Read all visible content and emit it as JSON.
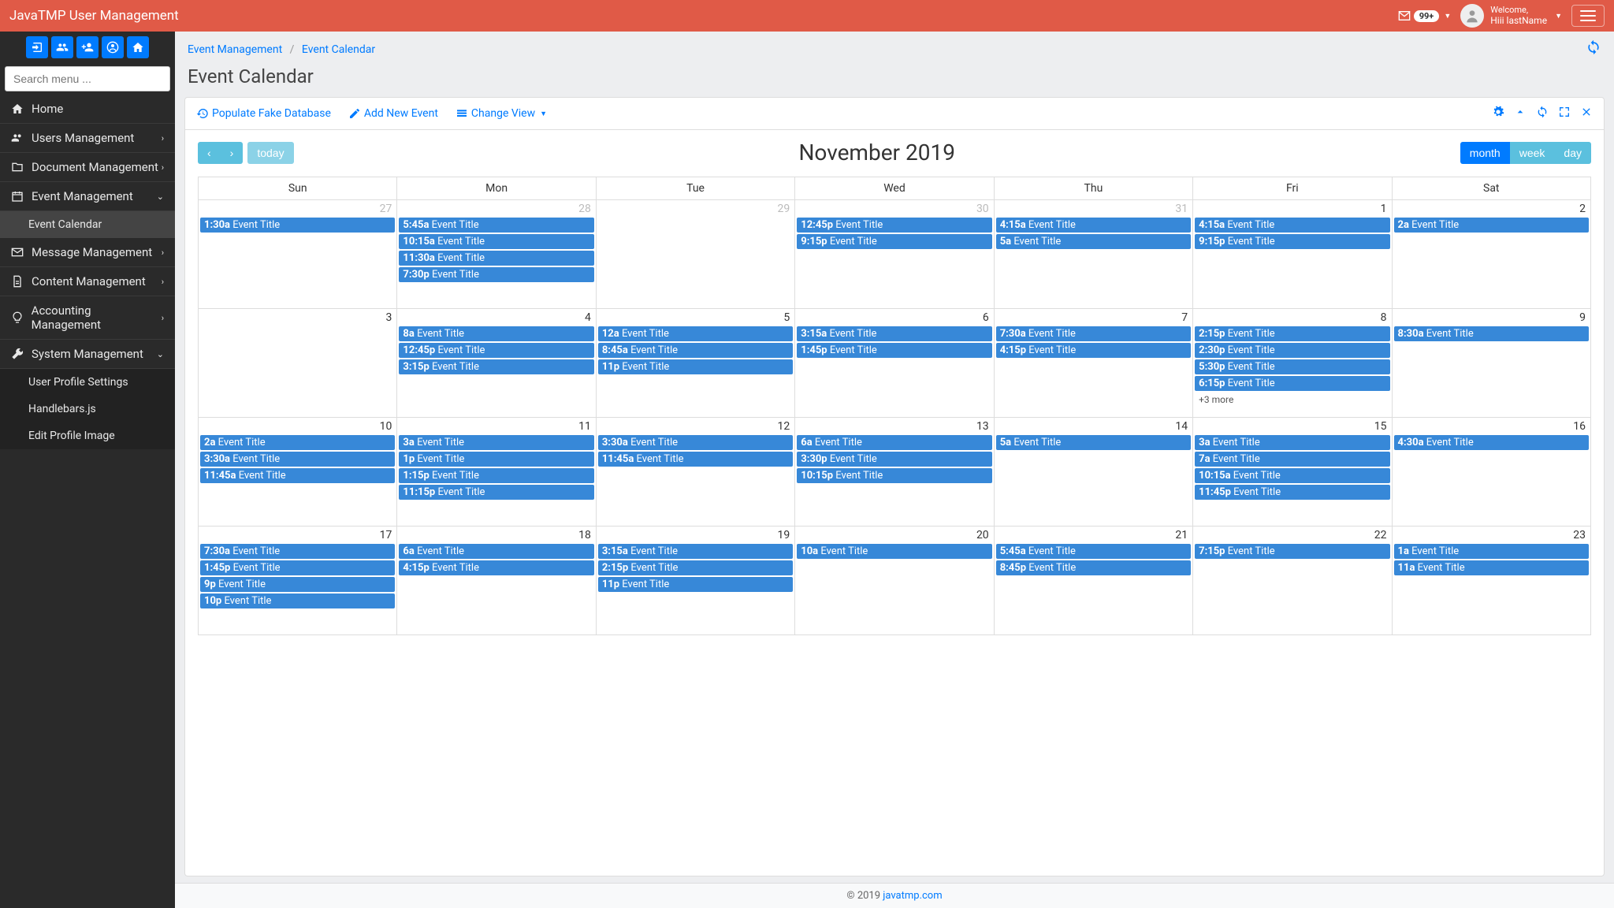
{
  "app": {
    "title": "JavaTMP User Management"
  },
  "header": {
    "notification_count": "99+",
    "welcome": "Welcome,",
    "username": "Hiii lastName"
  },
  "sidebar": {
    "search_placeholder": "Search menu ...",
    "items": [
      {
        "label": "Home",
        "icon": "home"
      },
      {
        "label": "Users Management",
        "icon": "users",
        "expandable": true
      },
      {
        "label": "Document Management",
        "icon": "folder",
        "expandable": true
      },
      {
        "label": "Event Management",
        "icon": "calendar",
        "expandable": true,
        "open": true,
        "children": [
          {
            "label": "Event Calendar",
            "active": true
          }
        ]
      },
      {
        "label": "Message Management",
        "icon": "mail",
        "expandable": true
      },
      {
        "label": "Content Management",
        "icon": "doc",
        "expandable": true
      },
      {
        "label": "Accounting Management",
        "icon": "bulb",
        "expandable": true
      },
      {
        "label": "System Management",
        "icon": "wrench",
        "expandable": true,
        "open": true,
        "children": [
          {
            "label": "User Profile Settings"
          },
          {
            "label": "Handlebars.js"
          },
          {
            "label": "Edit Profile Image"
          }
        ]
      }
    ]
  },
  "breadcrumb": {
    "parent": "Event Management",
    "current": "Event Calendar"
  },
  "page": {
    "title": "Event Calendar"
  },
  "panel_actions": {
    "populate": "Populate Fake Database",
    "add": "Add New Event",
    "view": "Change View"
  },
  "calendar": {
    "title": "November 2019",
    "today_label": "today",
    "views": {
      "month": "month",
      "week": "week",
      "day": "day"
    },
    "day_headers": [
      "Sun",
      "Mon",
      "Tue",
      "Wed",
      "Thu",
      "Fri",
      "Sat"
    ],
    "weeks": [
      [
        {
          "num": "27",
          "other": true,
          "events": [
            {
              "t": "1:30a",
              "title": "Event Title"
            }
          ]
        },
        {
          "num": "28",
          "other": true,
          "events": [
            {
              "t": "5:45a",
              "title": "Event Title"
            },
            {
              "t": "10:15a",
              "title": "Event Title"
            },
            {
              "t": "11:30a",
              "title": "Event Title"
            },
            {
              "t": "7:30p",
              "title": "Event Title"
            }
          ]
        },
        {
          "num": "29",
          "other": true,
          "events": []
        },
        {
          "num": "30",
          "other": true,
          "events": [
            {
              "t": "12:45p",
              "title": "Event Title"
            },
            {
              "t": "9:15p",
              "title": "Event Title"
            }
          ]
        },
        {
          "num": "31",
          "other": true,
          "events": [
            {
              "t": "4:15a",
              "title": "Event Title"
            },
            {
              "t": "5a",
              "title": "Event Title"
            }
          ]
        },
        {
          "num": "1",
          "events": [
            {
              "t": "4:15a",
              "title": "Event Title"
            },
            {
              "t": "9:15p",
              "title": "Event Title"
            }
          ]
        },
        {
          "num": "2",
          "events": [
            {
              "t": "2a",
              "title": "Event Title"
            }
          ]
        }
      ],
      [
        {
          "num": "3",
          "events": []
        },
        {
          "num": "4",
          "events": [
            {
              "t": "8a",
              "title": "Event Title"
            },
            {
              "t": "12:45p",
              "title": "Event Title"
            },
            {
              "t": "3:15p",
              "title": "Event Title"
            }
          ]
        },
        {
          "num": "5",
          "events": [
            {
              "t": "12a",
              "title": "Event Title"
            },
            {
              "t": "8:45a",
              "title": "Event Title"
            },
            {
              "t": "11p",
              "title": "Event Title"
            }
          ]
        },
        {
          "num": "6",
          "events": [
            {
              "t": "3:15a",
              "title": "Event Title"
            },
            {
              "t": "1:45p",
              "title": "Event Title"
            }
          ]
        },
        {
          "num": "7",
          "events": [
            {
              "t": "7:30a",
              "title": "Event Title"
            },
            {
              "t": "4:15p",
              "title": "Event Title"
            }
          ]
        },
        {
          "num": "8",
          "events": [
            {
              "t": "2:15p",
              "title": "Event Title"
            },
            {
              "t": "2:30p",
              "title": "Event Title"
            },
            {
              "t": "5:30p",
              "title": "Event Title"
            },
            {
              "t": "6:15p",
              "title": "Event Title"
            }
          ],
          "more": "+3 more"
        },
        {
          "num": "9",
          "events": [
            {
              "t": "8:30a",
              "title": "Event Title"
            }
          ]
        }
      ],
      [
        {
          "num": "10",
          "events": [
            {
              "t": "2a",
              "title": "Event Title"
            },
            {
              "t": "3:30a",
              "title": "Event Title"
            },
            {
              "t": "11:45a",
              "title": "Event Title"
            }
          ]
        },
        {
          "num": "11",
          "events": [
            {
              "t": "3a",
              "title": "Event Title"
            },
            {
              "t": "1p",
              "title": "Event Title"
            },
            {
              "t": "1:15p",
              "title": "Event Title"
            },
            {
              "t": "11:15p",
              "title": "Event Title"
            }
          ]
        },
        {
          "num": "12",
          "events": [
            {
              "t": "3:30a",
              "title": "Event Title"
            },
            {
              "t": "11:45a",
              "title": "Event Title"
            }
          ]
        },
        {
          "num": "13",
          "events": [
            {
              "t": "6a",
              "title": "Event Title"
            },
            {
              "t": "3:30p",
              "title": "Event Title"
            },
            {
              "t": "10:15p",
              "title": "Event Title"
            }
          ]
        },
        {
          "num": "14",
          "events": [
            {
              "t": "5a",
              "title": "Event Title"
            }
          ]
        },
        {
          "num": "15",
          "events": [
            {
              "t": "3a",
              "title": "Event Title"
            },
            {
              "t": "7a",
              "title": "Event Title"
            },
            {
              "t": "10:15a",
              "title": "Event Title"
            },
            {
              "t": "11:45p",
              "title": "Event Title"
            }
          ]
        },
        {
          "num": "16",
          "events": [
            {
              "t": "4:30a",
              "title": "Event Title"
            }
          ]
        }
      ],
      [
        {
          "num": "17",
          "events": [
            {
              "t": "7:30a",
              "title": "Event Title"
            },
            {
              "t": "1:45p",
              "title": "Event Title"
            },
            {
              "t": "9p",
              "title": "Event Title"
            },
            {
              "t": "10p",
              "title": "Event Title"
            }
          ]
        },
        {
          "num": "18",
          "events": [
            {
              "t": "6a",
              "title": "Event Title"
            },
            {
              "t": "4:15p",
              "title": "Event Title"
            }
          ]
        },
        {
          "num": "19",
          "events": [
            {
              "t": "3:15a",
              "title": "Event Title"
            },
            {
              "t": "2:15p",
              "title": "Event Title"
            },
            {
              "t": "11p",
              "title": "Event Title"
            }
          ]
        },
        {
          "num": "20",
          "events": [
            {
              "t": "10a",
              "title": "Event Title"
            }
          ]
        },
        {
          "num": "21",
          "events": [
            {
              "t": "5:45a",
              "title": "Event Title"
            },
            {
              "t": "8:45p",
              "title": "Event Title"
            }
          ]
        },
        {
          "num": "22",
          "events": [
            {
              "t": "7:15p",
              "title": "Event Title"
            }
          ]
        },
        {
          "num": "23",
          "events": [
            {
              "t": "1a",
              "title": "Event Title"
            },
            {
              "t": "11a",
              "title": "Event Title"
            }
          ]
        }
      ]
    ]
  },
  "footer": {
    "copyright": "© 2019 ",
    "link": "javatmp.com"
  }
}
